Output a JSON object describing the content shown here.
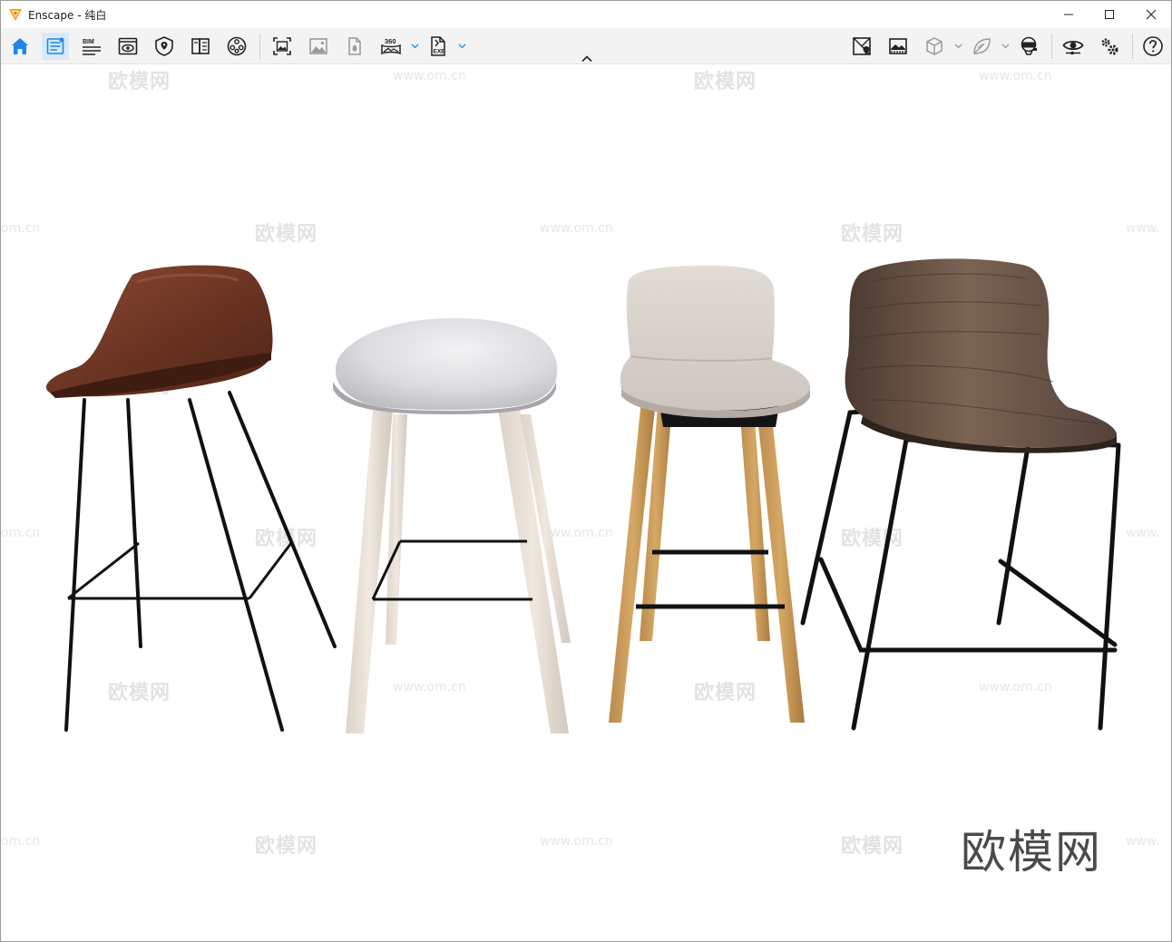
{
  "window": {
    "title": "Enscape - 纯白",
    "controls": [
      "minimize",
      "maximize",
      "close"
    ]
  },
  "toolbar": {
    "bim_label": "BIM",
    "pano_label": "360",
    "exe_label": "EXE",
    "accent_color": "#1e88e5",
    "left_icons": [
      "home-icon",
      "settings-panel-icon",
      "bim-icon",
      "view-icon",
      "map-pin-icon",
      "book-icon",
      "video-reel-icon",
      "screenshot-icon",
      "image-icon",
      "batch-render-icon",
      "panorama-icon",
      "exe-export-icon"
    ],
    "right_icons": [
      "map-view-icon",
      "gallery-icon",
      "cube-icon",
      "asset-leaf-icon",
      "vr-headset-icon",
      "eye-icon",
      "gears-icon",
      "help-icon"
    ]
  },
  "viewport": {
    "background": "#ffffff",
    "watermark_text": "欧模网",
    "watermark_url": "www.om.cn",
    "watermark_url_partial": "om.cn",
    "watermark_url_head": "www.",
    "brand_mark": "欧模网",
    "objects": [
      "leather-bar-stool",
      "white-shell-bar-stool",
      "fabric-bar-stool",
      "walnut-bar-stool"
    ]
  }
}
